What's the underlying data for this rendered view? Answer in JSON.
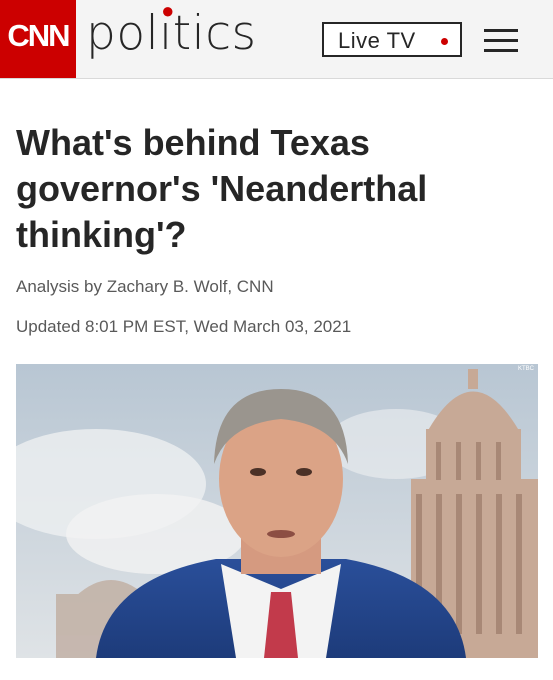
{
  "header": {
    "logo_text": "CNN",
    "section_title_pre": "pol",
    "section_title_i": "ı",
    "section_title_post": "tics",
    "live_tv_label": "Live TV",
    "menu_icon": "hamburger-menu-icon",
    "accent_color": "#cc0000"
  },
  "article": {
    "headline": "What's behind Texas governor's 'Neanderthal thinking'?",
    "byline": "Analysis by Zachary B. Wolf, CNN",
    "updated": "Updated 8:01 PM EST, Wed March 03, 2021"
  },
  "hero_image": {
    "watermark": "KTBC"
  }
}
